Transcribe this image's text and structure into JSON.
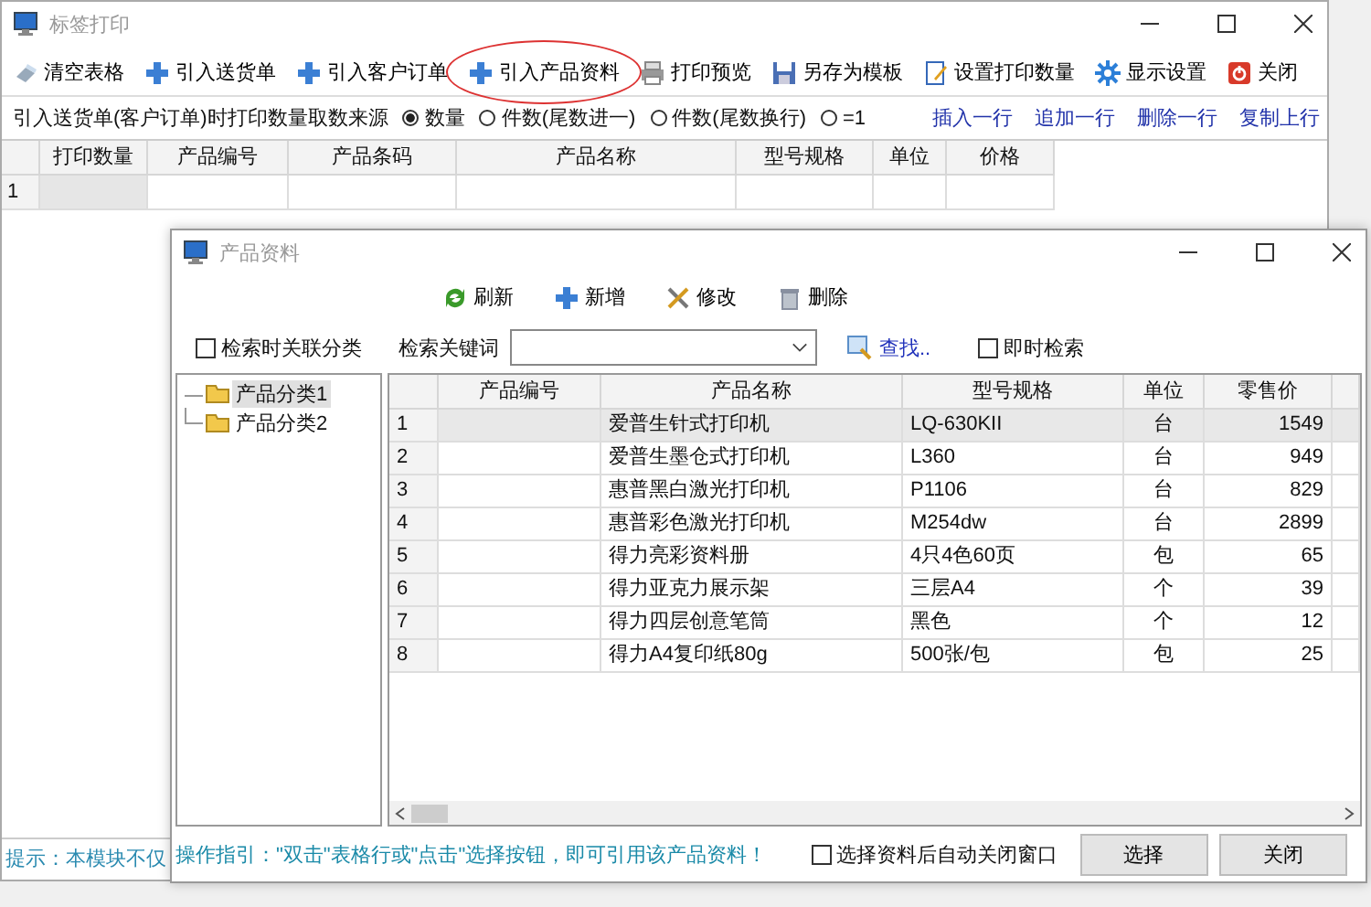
{
  "main_window": {
    "title": "标签打印",
    "toolbar": [
      {
        "kind": "clear",
        "label": "清空表格",
        "circled": false
      },
      {
        "kind": "add",
        "label": "引入送货单",
        "circled": false
      },
      {
        "kind": "add",
        "label": "引入客户订单",
        "circled": false
      },
      {
        "kind": "add",
        "label": "引入产品资料",
        "circled": true
      },
      {
        "kind": "print",
        "label": "打印预览",
        "circled": false
      },
      {
        "kind": "save",
        "label": "另存为模板",
        "circled": false
      },
      {
        "kind": "edit",
        "label": "设置打印数量",
        "circled": false
      },
      {
        "kind": "gear",
        "label": "显示设置",
        "circled": false
      },
      {
        "kind": "power",
        "label": "关闭",
        "circled": false
      }
    ],
    "quantity_source": {
      "label": "引入送货单(客户订单)时打印数量取数来源",
      "options": [
        {
          "label": "数量",
          "selected": true
        },
        {
          "label": "件数(尾数进一)",
          "selected": false
        },
        {
          "label": "件数(尾数换行)",
          "selected": false
        },
        {
          "label": "=1",
          "selected": false
        }
      ]
    },
    "row_actions": [
      "插入一行",
      "追加一行",
      "删除一行",
      "复制上行"
    ],
    "grid": {
      "columns": [
        "打印数量",
        "产品编号",
        "产品条码",
        "产品名称",
        "型号规格",
        "单位",
        "价格"
      ],
      "rows": [
        {
          "number": "1"
        }
      ]
    },
    "hint": "提示：本模块不仅"
  },
  "dialog": {
    "title": "产品资料",
    "toolbar": [
      {
        "kind": "refresh",
        "label": "刷新"
      },
      {
        "kind": "add",
        "label": "新增"
      },
      {
        "kind": "tools",
        "label": "修改"
      },
      {
        "kind": "trash",
        "label": "删除"
      }
    ],
    "link_category": {
      "label": "检索时关联分类",
      "checked": false
    },
    "search": {
      "label": "检索关键词"
    },
    "find_link": "查找..",
    "instant_search": {
      "label": "即时检索",
      "checked": false
    },
    "tree": [
      {
        "label": "产品分类1",
        "selected": true
      },
      {
        "label": "产品分类2",
        "selected": false
      }
    ],
    "grid": {
      "columns": [
        "产品编号",
        "产品名称",
        "型号规格",
        "单位",
        "零售价"
      ],
      "rows": [
        {
          "number": "1",
          "name": "爱普生针式打印机",
          "model": "LQ-630KII",
          "unit": "台",
          "price": "1549",
          "selected": true
        },
        {
          "number": "2",
          "name": "爱普生墨仓式打印机",
          "model": "L360",
          "unit": "台",
          "price": "949",
          "selected": false
        },
        {
          "number": "3",
          "name": "惠普黑白激光打印机",
          "model": "P1106",
          "unit": "台",
          "price": "829",
          "selected": false
        },
        {
          "number": "4",
          "name": "惠普彩色激光打印机",
          "model": "M254dw",
          "unit": "台",
          "price": "2899",
          "selected": false
        },
        {
          "number": "5",
          "name": "得力亮彩资料册",
          "model": "4只4色60页",
          "unit": "包",
          "price": "65",
          "selected": false
        },
        {
          "number": "6",
          "name": "得力亚克力展示架",
          "model": "三层A4",
          "unit": "个",
          "price": "39",
          "selected": false
        },
        {
          "number": "7",
          "name": "得力四层创意笔筒",
          "model": "黑色",
          "unit": "个",
          "price": "12",
          "selected": false
        },
        {
          "number": "8",
          "name": "得力A4复印纸80g",
          "model": "500张/包",
          "unit": "包",
          "price": "25",
          "selected": false
        }
      ]
    },
    "guide": "操作指引：\"双击\"表格行或\"点击\"选择按钮，即可引用该产品资料！",
    "auto_close": {
      "label": "选择资料后自动关闭窗口",
      "checked": false
    },
    "buttons": [
      "选择",
      "关闭"
    ]
  }
}
